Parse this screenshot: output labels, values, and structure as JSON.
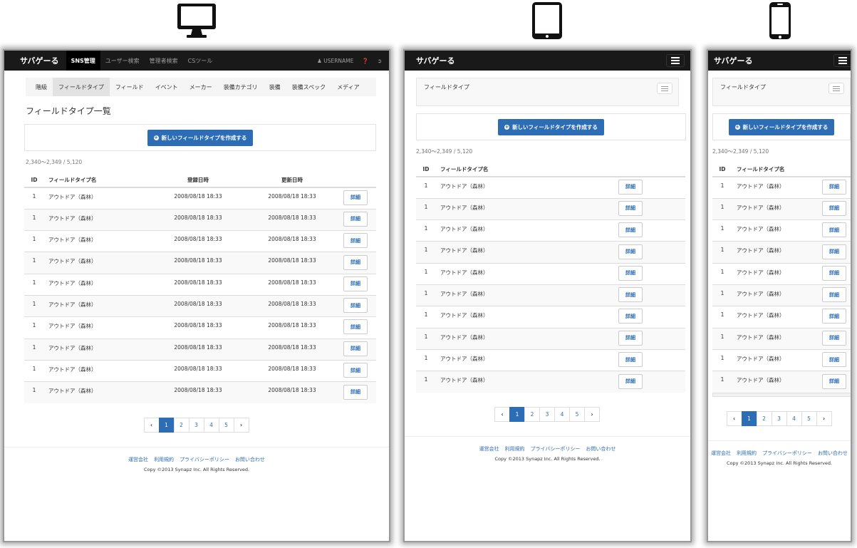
{
  "brand": "サバゲーる",
  "main_nav": [
    {
      "label": "SNS管理",
      "active": true
    },
    {
      "label": "ユーザー検索",
      "active": false
    },
    {
      "label": "管理者検索",
      "active": false
    },
    {
      "label": "CSツール",
      "active": false
    }
  ],
  "user": {
    "name": "USERNAME",
    "user_icon": "user-icon",
    "help_icon": "question-icon",
    "logout_icon": "logout-icon"
  },
  "sub_nav": [
    {
      "label": "階級",
      "active": false
    },
    {
      "label": "フィールドタイプ",
      "active": true
    },
    {
      "label": "フィールド",
      "active": false
    },
    {
      "label": "イベント",
      "active": false
    },
    {
      "label": "メーカー",
      "active": false
    },
    {
      "label": "装備カテゴリ",
      "active": false
    },
    {
      "label": "装備",
      "active": false
    },
    {
      "label": "装備スペック",
      "active": false
    },
    {
      "label": "メディア",
      "active": false
    }
  ],
  "sub_nav_collapsed_label": "フィールドタイプ",
  "page_title": "フィールドタイプ一覧",
  "create_button": "新しいフィールドタイプを作成する",
  "count_text": "2,340〜2,349 / 5,120",
  "table": {
    "headers": {
      "id": "ID",
      "name": "フィールドタイプ名",
      "created": "登録日時",
      "updated": "更新日時"
    },
    "rows": [
      {
        "id": "1",
        "name": "アウトドア（森林）",
        "created": "2008/08/18 18:33",
        "updated": "2008/08/18 18:33"
      },
      {
        "id": "1",
        "name": "アウトドア（森林）",
        "created": "2008/08/18 18:33",
        "updated": "2008/08/18 18:33"
      },
      {
        "id": "1",
        "name": "アウトドア（森林）",
        "created": "2008/08/18 18:33",
        "updated": "2008/08/18 18:33"
      },
      {
        "id": "1",
        "name": "アウトドア（森林）",
        "created": "2008/08/18 18:33",
        "updated": "2008/08/18 18:33"
      },
      {
        "id": "1",
        "name": "アウトドア（森林）",
        "created": "2008/08/18 18:33",
        "updated": "2008/08/18 18:33"
      },
      {
        "id": "1",
        "name": "アウトドア（森林）",
        "created": "2008/08/18 18:33",
        "updated": "2008/08/18 18:33"
      },
      {
        "id": "1",
        "name": "アウトドア（森林）",
        "created": "2008/08/18 18:33",
        "updated": "2008/08/18 18:33"
      },
      {
        "id": "1",
        "name": "アウトドア（森林）",
        "created": "2008/08/18 18:33",
        "updated": "2008/08/18 18:33"
      },
      {
        "id": "1",
        "name": "アウトドア（森林）",
        "created": "2008/08/18 18:33",
        "updated": "2008/08/18 18:33"
      },
      {
        "id": "1",
        "name": "アウトドア（森林）",
        "created": "2008/08/18 18:33",
        "updated": "2008/08/18 18:33"
      }
    ],
    "detail_label": "詳細"
  },
  "pagination": {
    "prev": "‹",
    "pages": [
      "1",
      "2",
      "3",
      "4",
      "5"
    ],
    "active": "1",
    "next": "›"
  },
  "footer": {
    "links": [
      "運営会社",
      "利用規約",
      "プライバシーポリシー",
      "お問い合わせ"
    ],
    "copyright": "Copy ©2013 Synapz Inc. All Rights Reserved."
  },
  "device_icons": [
    "desktop-icon",
    "tablet-icon",
    "phone-icon"
  ],
  "colors": {
    "navbar": "#191919",
    "primary": "#2c6db5",
    "subnav_bg": "#f5f5f5"
  }
}
